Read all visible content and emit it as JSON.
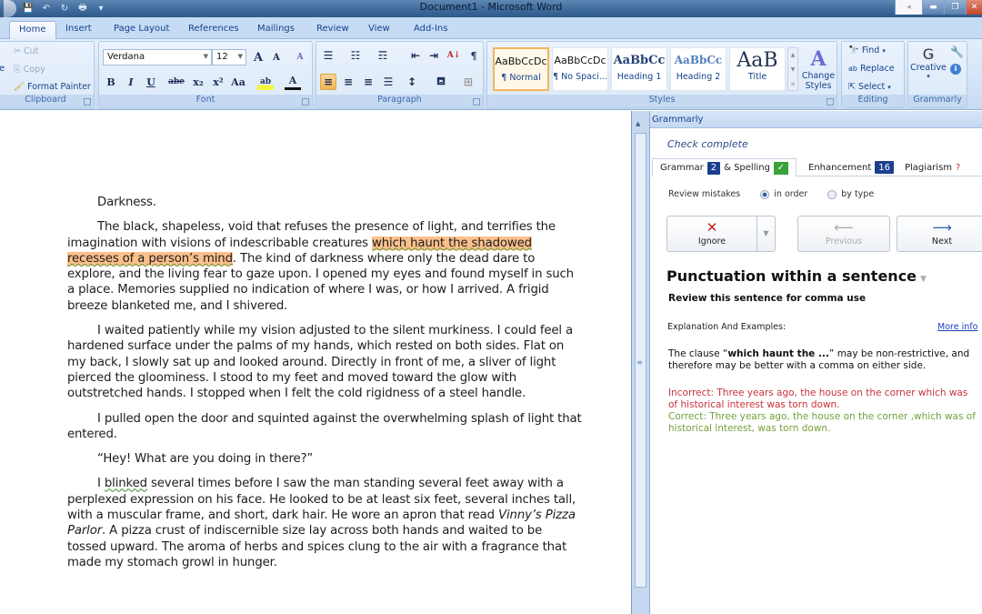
{
  "window": {
    "title": "Document1 - Microsoft Word",
    "controls": {
      "help": "◂",
      "minimize": "▬",
      "restore": "❐",
      "close": "✕"
    }
  },
  "quick_access": [
    {
      "name": "save-icon",
      "glyph": "💾"
    },
    {
      "name": "undo-icon",
      "glyph": "↶"
    },
    {
      "name": "redo-icon",
      "glyph": "↻"
    },
    {
      "name": "print-icon",
      "glyph": "🖶"
    },
    {
      "name": "customize-icon",
      "glyph": "▾"
    }
  ],
  "ribbon_tabs": [
    "Home",
    "Insert",
    "Page Layout",
    "References",
    "Mailings",
    "Review",
    "View",
    "Add-Ins"
  ],
  "active_tab": "Home",
  "clipboard": {
    "label": "Clipboard",
    "paste_partial": "e",
    "cut": "Cut",
    "copy": "Copy",
    "format_painter": "Format Painter"
  },
  "font": {
    "label": "Font",
    "font_name": "Verdana",
    "font_size": "12",
    "grow": "A",
    "shrink": "A",
    "bold": "B",
    "italic": "I",
    "underline": "U",
    "strikethrough": "abe",
    "subscript": "x₂",
    "superscript": "x²",
    "change_case": "Aa",
    "highlight": "ab",
    "font_color": "A",
    "clear": "A"
  },
  "paragraph": {
    "label": "Paragraph",
    "show_marks": "¶",
    "sort": "A↓"
  },
  "styles": {
    "label": "Styles",
    "items": [
      {
        "preview": "AaBbCcDc",
        "name": "¶ Normal",
        "selected": true
      },
      {
        "preview": "AaBbCcDc",
        "name": "¶ No Spaci...",
        "selected": false
      },
      {
        "preview": "AaBbCc",
        "name": "Heading 1",
        "selected": false
      },
      {
        "preview": "AaBbCc",
        "name": "Heading 2",
        "selected": false
      },
      {
        "preview": "AaB",
        "name": "Title",
        "selected": false
      }
    ],
    "change_styles": "Change Styles"
  },
  "editing": {
    "label": "Editing",
    "find": "Find",
    "replace": "Replace",
    "select": "Select"
  },
  "grammarly_group": {
    "label": "Grammarly",
    "mode": "Creative"
  },
  "document": {
    "paragraphs": [
      {
        "parts": [
          {
            "t": "Darkness."
          }
        ]
      },
      {
        "parts": [
          {
            "t": "The black, shapeless, void that refuses the presence of light, and terrifies the imagination with visions of indescribable creatures "
          },
          {
            "t": "which haunt the shadowed recesses of a person’s mind",
            "style": "highlight"
          },
          {
            "t": ". The kind of darkness where only the dead dare to explore, and the living fear to gaze upon. I opened my eyes and found myself in such a place. Memories supplied no indication of where I was, or how I arrived. A frigid breeze blanketed me, and I shivered."
          }
        ]
      },
      {
        "parts": [
          {
            "t": "I waited patiently while my vision adjusted to the silent murkiness. I could feel a hardened surface under the palms of my hands, which rested on both sides. Flat on my back, I slowly sat up and looked around. Directly in front of me, a sliver of light pierced the gloominess. I stood to my feet and moved toward the glow with outstretched hands. I stopped when I felt the cold rigidness of a steel handle."
          }
        ]
      },
      {
        "parts": [
          {
            "t": "I pulled open the door and squinted against the overwhelming splash of light that entered."
          }
        ]
      },
      {
        "parts": [
          {
            "t": "“Hey! What are you doing in there?”"
          }
        ]
      },
      {
        "parts": [
          {
            "t": "I "
          },
          {
            "t": "blinked",
            "style": "spelling"
          },
          {
            "t": " several times before I saw the man standing several feet away with a perplexed expression on his face. He looked to be at least six feet, several inches tall, with a muscular frame, and short, dark hair. He wore an apron that read "
          },
          {
            "t": "Vinny’s Pizza Parlor",
            "style": "italic"
          },
          {
            "t": ". A pizza crust of indiscernible size lay across both hands and waited to be tossed upward. The aroma of herbs and spices clung to the air with a fragrance that made my stomach growl in hunger."
          }
        ]
      }
    ]
  },
  "pane": {
    "title": "Grammarly",
    "status": "Check complete",
    "tabs": {
      "grammar": "Grammar",
      "grammar_count": "2",
      "spelling": "& Spelling",
      "spelling_check": "✓",
      "enhancement": "Enhancement",
      "enhancement_count": "16",
      "plagiarism": "Plagiarism",
      "plagiarism_status": "?"
    },
    "review_label": "Review mistakes",
    "review_options": [
      {
        "label": "in order",
        "selected": true
      },
      {
        "label": "by type",
        "selected": false
      }
    ],
    "buttons": {
      "ignore": "Ignore",
      "previous": "Previous",
      "next": "Next"
    },
    "issue_title": "Punctuation within a sentence",
    "issue_subtitle": "Review this sentence for comma use",
    "explanation_label": "Explanation And Examples:",
    "more_info": "More info",
    "explanation_pre": "The clause “",
    "explanation_bold": "which haunt the ...",
    "explanation_post": "” may be non-restrictive, and therefore may be better with a comma on either side.",
    "incorrect": "Incorrect: Three years ago, the house on the corner which was of historical interest was torn down.",
    "correct": "Correct: Three years ago, the house on the corner ,which was of historical interest, was torn down.",
    "colors": {
      "incorrect": "#c8323a",
      "correct": "#74a03a",
      "badge": "#1b3f8f",
      "check": "#3aa23a"
    }
  }
}
